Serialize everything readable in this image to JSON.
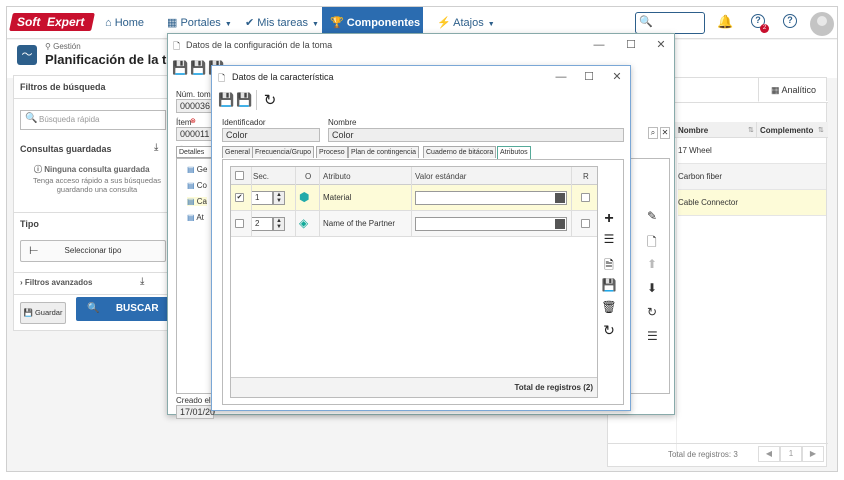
{
  "brand": {
    "part1": "Soft",
    "part2": "Expert"
  },
  "nav": {
    "home": "Home",
    "portales": "Portales",
    "tareas": "Mis tareas",
    "componentes": "Componentes",
    "atajos": "Atajos"
  },
  "notif": {
    "count": "2"
  },
  "header": {
    "module": "Gestión",
    "title": "Planificación de la toma"
  },
  "sidebar": {
    "title": "Filtros de búsqueda",
    "search_placeholder": "Búsqueda rápida",
    "saved": "Consultas guardadas",
    "none": "Ninguna consulta guardada",
    "hint1": "Tenga acceso rápido a sus búsquedas",
    "hint2": "guardando una consulta",
    "tipo": "Tipo",
    "select_type": "Seleccionar tipo",
    "advanced": "Filtros avanzados",
    "save": "Guardar",
    "search": "BUSCAR"
  },
  "win1": {
    "title": "Datos de la configuración de la toma",
    "num_label": "Núm. toma",
    "num_value": "000036",
    "item_label": "Ítem",
    "item_value": "000011 -",
    "tab_detalles": "Detalles",
    "tree": [
      "Ge",
      "Co",
      "Ca",
      "At"
    ],
    "created_label": "Creado el",
    "created_value": "17/01/20"
  },
  "right": {
    "tab": "Analítico",
    "col1": "Nombre",
    "col2": "Complemento",
    "rows": [
      "17 Wheel",
      "Carbon fiber",
      "Cable Connector"
    ],
    "total": "Total de registros: 3",
    "page": "1"
  },
  "win2": {
    "title": "Datos de la característica",
    "id_label": "Identificador",
    "id_value": "Color",
    "name_label": "Nombre",
    "name_value": "Color",
    "tabs": [
      "General",
      "Frecuencia/Grupo",
      "Proceso",
      "Plan de contingencia",
      "Cuaderno de bitácora",
      "Atributos"
    ],
    "cols": {
      "sec": "Sec.",
      "o": "O",
      "atributo": "Atributo",
      "valor": "Valor estándar",
      "r": "R"
    },
    "rows": [
      {
        "sec": "1",
        "attr": "Material",
        "checked": true
      },
      {
        "sec": "2",
        "attr": "Name of the Partner",
        "checked": false
      }
    ],
    "total": "Total de registros (2)"
  },
  "colors": {
    "accent": "#2b6cb0",
    "brand": "#c8102e",
    "highlight": "#fdfbd8"
  }
}
